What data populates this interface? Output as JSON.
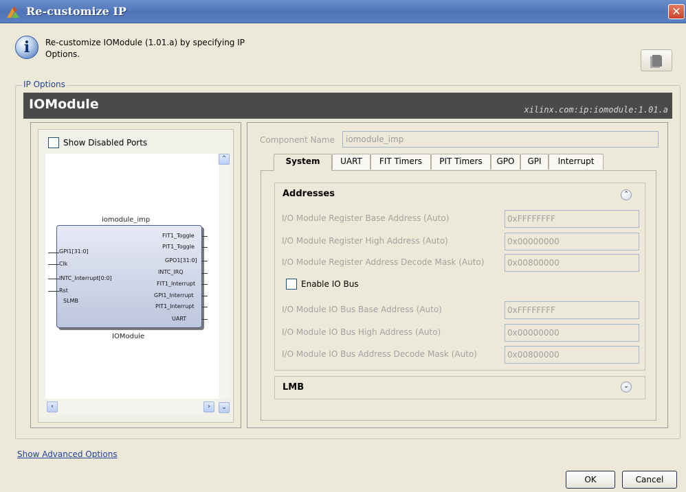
{
  "window": {
    "title": "Re-customize IP",
    "close_glyph": "✕"
  },
  "header": {
    "info_glyph": "i",
    "description": "Re-customize IOModule (1.01.a) by specifying IP Options."
  },
  "ip_options": {
    "legend": "IP Options",
    "module_name": "IOModule",
    "vlnv": "xilinx.com:ip:iomodule:1.01.a"
  },
  "left_panel": {
    "show_disabled_ports_label": "Show Disabled Ports",
    "show_disabled_ports_checked": false,
    "block": {
      "instance_name": "iomodule_imp",
      "type_name": "IOModule",
      "left_pins": [
        "GPI1[31:0]",
        "Clk",
        "INTC_Interrupt[0:0]",
        "Rst",
        "SLMB"
      ],
      "right_pins": [
        "FIT1_Toggle",
        "PIT1_Toggle",
        "GPO1[31:0]",
        "INTC_IRQ",
        "FIT1_Interrupt",
        "GPI1_Interrupt",
        "PIT1_Interrupt",
        "UART"
      ]
    }
  },
  "right_panel": {
    "component_name_label": "Component Name",
    "component_name_value": "iomodule_imp",
    "tabs": [
      "System",
      "UART",
      "FIT Timers",
      "PIT Timers",
      "GPO",
      "GPI",
      "Interrupt"
    ],
    "active_tab": "System",
    "addresses": {
      "title": "Addresses",
      "collapse_glyph": "⌃",
      "fields": [
        {
          "label": "I/O Module Register Base Address (Auto)",
          "value": "0xFFFFFFFF"
        },
        {
          "label": "I/O Module Register High Address (Auto)",
          "value": "0x00000000"
        },
        {
          "label": "I/O Module Register Address Decode Mask (Auto)",
          "value": "0x00800000"
        }
      ],
      "enable_io_bus_label": "Enable IO Bus",
      "enable_io_bus_checked": false,
      "io_bus_fields": [
        {
          "label": "I/O Module IO Bus Base Address (Auto)",
          "value": "0xFFFFFFFF"
        },
        {
          "label": "I/O Module IO Bus High Address (Auto)",
          "value": "0x00000000"
        },
        {
          "label": "I/O Module IO Bus Address Decode Mask (Auto)",
          "value": "0x00800000"
        }
      ]
    },
    "lmb": {
      "title": "LMB",
      "expand_glyph": "⌄"
    }
  },
  "footer": {
    "advanced_link": "Show Advanced Options",
    "ok_label": "OK",
    "cancel_label": "Cancel"
  }
}
